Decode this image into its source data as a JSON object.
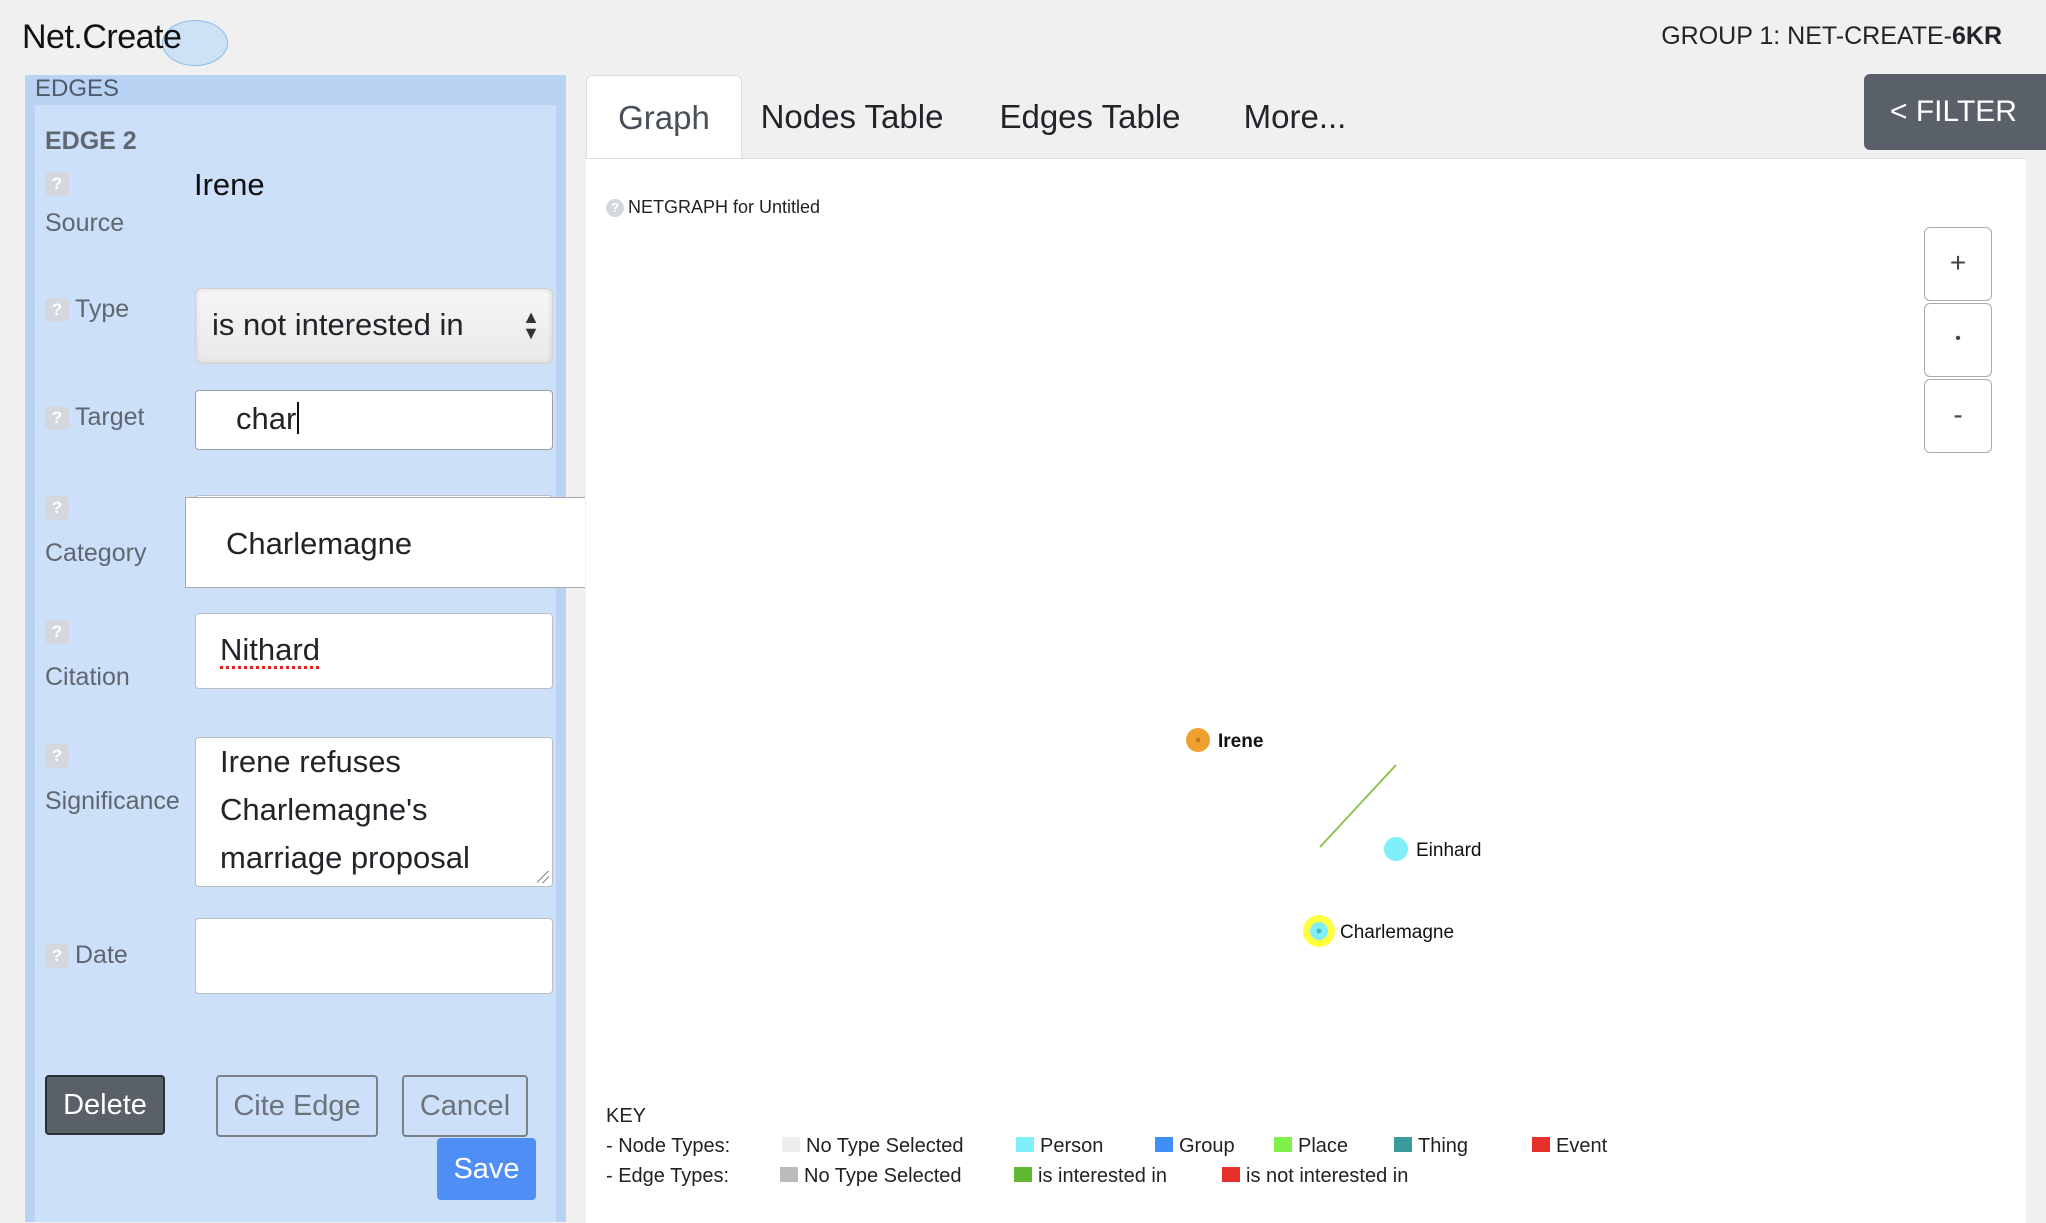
{
  "app": {
    "logo": "Net.Create",
    "group_prefix": "GROUP 1: NET-CREATE-",
    "group_suffix": "6KR"
  },
  "edges_panel": {
    "header": "EDGES",
    "edge_title": "EDGE 2",
    "help_glyph": "?",
    "source": {
      "label": "Source",
      "value": "Irene"
    },
    "type": {
      "label": "Type",
      "value": "is not interested in"
    },
    "target": {
      "label": "Target",
      "value": "char"
    },
    "category": {
      "label": "Category",
      "value": ""
    },
    "citation": {
      "label": "Citation",
      "value": "Nithard"
    },
    "significance": {
      "label": "Significance",
      "value": "Irene refuses Charlemagne's marriage proposal"
    },
    "date": {
      "label": "Date",
      "value": ""
    },
    "buttons": {
      "delete": "Delete",
      "cite": "Cite Edge",
      "cancel": "Cancel",
      "save": "Save"
    }
  },
  "autocomplete": {
    "suggestion": "Charlemagne"
  },
  "tabs": [
    "Graph",
    "Nodes Table",
    "Edges Table",
    "More..."
  ],
  "filter_button": "< FILTER",
  "graph": {
    "title": "NETGRAPH for Untitled",
    "zoom": {
      "in": "+",
      "reset": "•",
      "out": "-"
    },
    "nodes": [
      {
        "label": "Irene",
        "color": "#f0a030"
      },
      {
        "label": "Einhard",
        "color": "#7ff0fa"
      },
      {
        "label": "Charlemagne",
        "color": "#7ff0fa",
        "highlight": "#ffff40"
      }
    ],
    "edge_color": "#8bc34a"
  },
  "key": {
    "title": "KEY",
    "node_types_label": "- Node Types:",
    "edge_types_label": "- Edge Types:",
    "node_types": [
      {
        "label": "No Type Selected",
        "color": "#eeeeee"
      },
      {
        "label": "Person",
        "color": "#7ff0fa"
      },
      {
        "label": "Group",
        "color": "#3f8ef5"
      },
      {
        "label": "Place",
        "color": "#80f04a"
      },
      {
        "label": "Thing",
        "color": "#3a9b9b"
      },
      {
        "label": "Event",
        "color": "#e8302a"
      }
    ],
    "edge_types": [
      {
        "label": "No Type Selected",
        "color": "#bbbbbb"
      },
      {
        "label": "is interested in",
        "color": "#5fb830"
      },
      {
        "label": "is not interested in",
        "color": "#e8302a"
      }
    ]
  }
}
